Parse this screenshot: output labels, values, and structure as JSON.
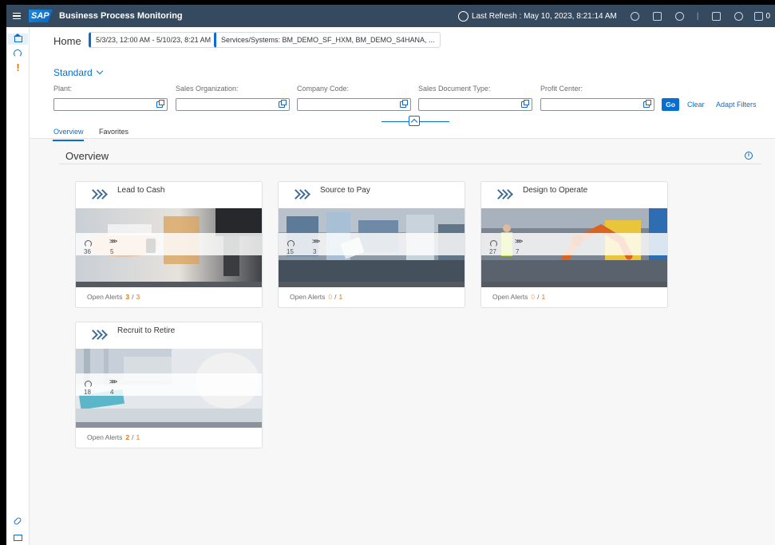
{
  "shell": {
    "title": "Business Process Monitoring",
    "logo_text": "SAP",
    "last_refresh_label": "Last Refresh : May 10, 2023, 8:21:14 AM",
    "notification_count": "0"
  },
  "header": {
    "home": "Home",
    "date_token": "5/3/23, 12:00 AM - 5/10/23, 8:21 AM",
    "services_token": "Services/Systems: BM_DEMO_SF_HXM, BM_DEMO_S4HANA, ...",
    "variant": "Standard"
  },
  "filters": [
    {
      "label": "Plant:",
      "value": ""
    },
    {
      "label": "Sales Organization:",
      "value": ""
    },
    {
      "label": "Company Code:",
      "value": ""
    },
    {
      "label": "Sales Document Type:",
      "value": ""
    },
    {
      "label": "Profit Center:",
      "value": ""
    }
  ],
  "filterbar": {
    "go": "Go",
    "clear": "Clear",
    "adapt": "Adapt Filters"
  },
  "tabs": [
    {
      "label": "Overview",
      "active": true
    },
    {
      "label": "Favorites",
      "active": false
    }
  ],
  "section": {
    "title": "Overview"
  },
  "cards": [
    {
      "title": "Lead to Cash",
      "metric1": "36",
      "metric2": "5",
      "alerts_label": "Open Alerts",
      "alerts_open": "3",
      "alerts_total": "3"
    },
    {
      "title": "Source to Pay",
      "metric1": "15",
      "metric2": "3",
      "alerts_label": "Open Alerts",
      "alerts_open": "0",
      "alerts_total": "1"
    },
    {
      "title": "Design to Operate",
      "metric1": "27",
      "metric2": "7",
      "alerts_label": "Open Alerts",
      "alerts_open": "0",
      "alerts_total": "1"
    },
    {
      "title": "Recruit to Retire",
      "metric1": "18",
      "metric2": "4",
      "alerts_label": "Open Alerts",
      "alerts_open": "2",
      "alerts_total": "1"
    }
  ],
  "colors": {
    "shell": "#354a5f",
    "accent": "#0a6ed1",
    "alert": "#e9730c"
  }
}
